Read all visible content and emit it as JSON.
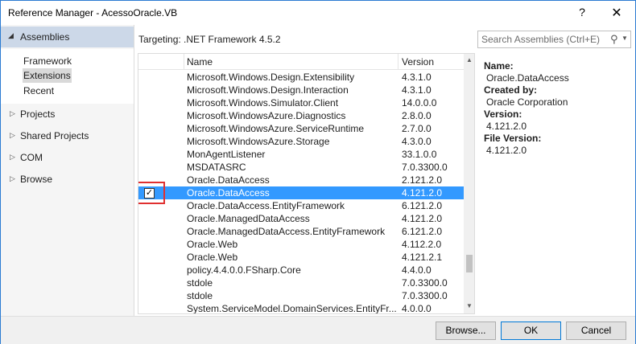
{
  "window": {
    "title": "Reference Manager - AcessoOracle.VB",
    "help_glyph": "?",
    "close_glyph": "✕"
  },
  "sidebar": {
    "assemblies": "Assemblies",
    "sub_items": [
      "Framework",
      "Extensions",
      "Recent"
    ],
    "selected_sub": "Extensions",
    "items": [
      "Projects",
      "Shared Projects",
      "COM",
      "Browse"
    ]
  },
  "targeting": "Targeting: .NET Framework 4.5.2",
  "search": {
    "placeholder": "Search Assemblies (Ctrl+E)"
  },
  "list": {
    "headers": {
      "name": "Name",
      "version": "Version"
    },
    "rows": [
      {
        "name": "Microsoft.Windows.Design.Extensibility",
        "version": "4.3.1.0",
        "checked": false,
        "selected": false
      },
      {
        "name": "Microsoft.Windows.Design.Interaction",
        "version": "4.3.1.0",
        "checked": false,
        "selected": false
      },
      {
        "name": "Microsoft.Windows.Simulator.Client",
        "version": "14.0.0.0",
        "checked": false,
        "selected": false
      },
      {
        "name": "Microsoft.WindowsAzure.Diagnostics",
        "version": "2.8.0.0",
        "checked": false,
        "selected": false
      },
      {
        "name": "Microsoft.WindowsAzure.ServiceRuntime",
        "version": "2.7.0.0",
        "checked": false,
        "selected": false
      },
      {
        "name": "Microsoft.WindowsAzure.Storage",
        "version": "4.3.0.0",
        "checked": false,
        "selected": false
      },
      {
        "name": "MonAgentListener",
        "version": "33.1.0.0",
        "checked": false,
        "selected": false
      },
      {
        "name": "MSDATASRC",
        "version": "7.0.3300.0",
        "checked": false,
        "selected": false
      },
      {
        "name": "Oracle.DataAccess",
        "version": "2.121.2.0",
        "checked": false,
        "selected": false
      },
      {
        "name": "Oracle.DataAccess",
        "version": "4.121.2.0",
        "checked": true,
        "selected": true
      },
      {
        "name": "Oracle.DataAccess.EntityFramework",
        "version": "6.121.2.0",
        "checked": false,
        "selected": false
      },
      {
        "name": "Oracle.ManagedDataAccess",
        "version": "4.121.2.0",
        "checked": false,
        "selected": false
      },
      {
        "name": "Oracle.ManagedDataAccess.EntityFramework",
        "version": "6.121.2.0",
        "checked": false,
        "selected": false
      },
      {
        "name": "Oracle.Web",
        "version": "4.112.2.0",
        "checked": false,
        "selected": false
      },
      {
        "name": "Oracle.Web",
        "version": "4.121.2.1",
        "checked": false,
        "selected": false
      },
      {
        "name": "policy.4.4.0.0.FSharp.Core",
        "version": "4.4.0.0",
        "checked": false,
        "selected": false
      },
      {
        "name": "stdole",
        "version": "7.0.3300.0",
        "checked": false,
        "selected": false
      },
      {
        "name": "stdole",
        "version": "7.0.3300.0",
        "checked": false,
        "selected": false
      },
      {
        "name": "System.ServiceModel.DomainServices.EntityFr...",
        "version": "4.0.0.0",
        "checked": false,
        "selected": false
      }
    ]
  },
  "details": {
    "name_label": "Name:",
    "name_value": "Oracle.DataAccess",
    "created_label": "Created by:",
    "created_value": "Oracle Corporation",
    "version_label": "Version:",
    "version_value": "4.121.2.0",
    "file_version_label": "File Version:",
    "file_version_value": "4.121.2.0"
  },
  "buttons": {
    "browse": "Browse...",
    "ok": "OK",
    "cancel": "Cancel"
  },
  "colors": {
    "selection": "#3399ff",
    "highlight_box": "#e03030",
    "nav_selected": "#ccd8e8"
  }
}
